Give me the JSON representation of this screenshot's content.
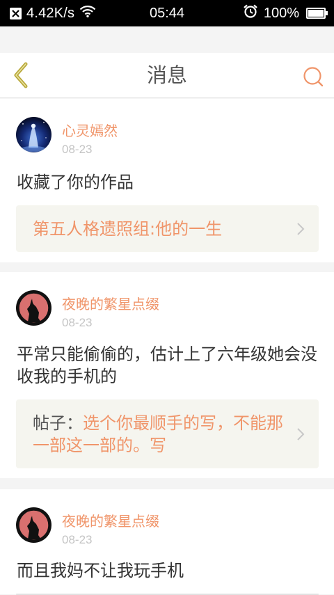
{
  "status_bar": {
    "speed": "4.42K/s",
    "time": "05:44",
    "battery": "100%"
  },
  "header": {
    "title": "消息"
  },
  "messages": [
    {
      "user": "心灵嫣然",
      "date": "08-23",
      "text": "收藏了你的作品",
      "ref": {
        "prefix": "",
        "text": "第五人格遗照组:他的一生"
      }
    },
    {
      "user": "夜晚的繁星点缀",
      "date": "08-23",
      "text": "平常只能偷偷的，估计上了六年级她会没收我的手机的",
      "ref": {
        "prefix": "帖子：",
        "text": "选个你最顺手的写，不能那一部这一部的。写"
      }
    },
    {
      "user": "夜晚的繁星点缀",
      "date": "08-23",
      "text": "而且我妈不让我玩手机"
    }
  ],
  "colors": {
    "accent": "#f0956a",
    "back_icon": "#b8a83a",
    "text": "#333333",
    "date": "#c4c4c4",
    "ref_bg": "#f5f5ef"
  },
  "icons": {
    "back": "chevron-left-icon",
    "search": "search-icon",
    "ref_arrow": "chevron-right-icon",
    "status_x": "close-box-icon",
    "wifi": "wifi-icon",
    "alarm": "alarm-icon",
    "battery": "battery-icon"
  }
}
